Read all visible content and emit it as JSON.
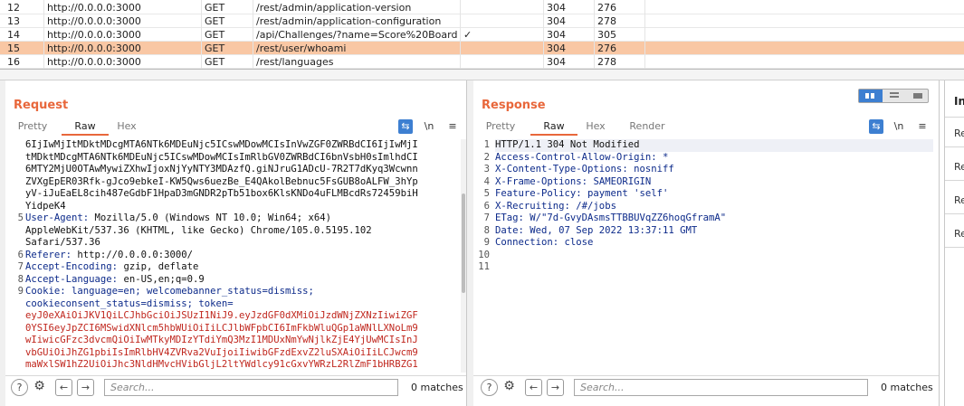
{
  "history": {
    "rows": [
      {
        "num": "12",
        "host": "http://0.0.0.0:3000",
        "method": "GET",
        "url": "/rest/admin/application-version",
        "params": "",
        "status": "304",
        "length": "276",
        "selected": false
      },
      {
        "num": "13",
        "host": "http://0.0.0.0:3000",
        "method": "GET",
        "url": "/rest/admin/application-configuration",
        "params": "",
        "status": "304",
        "length": "278",
        "selected": false
      },
      {
        "num": "14",
        "host": "http://0.0.0.0:3000",
        "method": "GET",
        "url": "/api/Challenges/?name=Score%20Board",
        "params": "✓",
        "status": "304",
        "length": "305",
        "selected": false
      },
      {
        "num": "15",
        "host": "http://0.0.0.0:3000",
        "method": "GET",
        "url": "/rest/user/whoami",
        "params": "",
        "status": "304",
        "length": "276",
        "selected": true
      },
      {
        "num": "16",
        "host": "http://0.0.0.0:3000",
        "method": "GET",
        "url": "/rest/languages",
        "params": "",
        "status": "304",
        "length": "278",
        "selected": false
      }
    ]
  },
  "request": {
    "title": "Request",
    "tabs": [
      "Pretty",
      "Raw",
      "Hex"
    ],
    "active_tab": "Raw",
    "wrap_icon": "wrap-lines-icon",
    "newline_label": "\\n",
    "menu_icon": "hamburger-menu-icon",
    "lines": [
      {
        "n": "",
        "k": "",
        "v": "6IjIwMjItMDktMDcgMTA6NTk6MDEuNjc5ICswMDowMCIsInVwZGF0ZWRBdCI6IjIwMjI",
        "cls": "hv"
      },
      {
        "n": "",
        "k": "",
        "v": "tMDktMDcgMTA6NTk6MDEuNjc5ICswMDowMCIsImRlbGV0ZWRBdCI6bnVsbH0sImlhdCI",
        "cls": "hv"
      },
      {
        "n": "",
        "k": "",
        "v": "6MTY2MjU0OTAwMywiZXhwIjoxNjYyNTY3MDAzfQ.giNJruG1ADcU-7R2T7dKyq3Wcwnn",
        "cls": "hv"
      },
      {
        "n": "",
        "k": "",
        "v": "ZVXgEpER03Rfk-gJco9ebkeI-KW5Qws6uezBe_E4QAkolBebnuc5FsGUB8oALFW_3hYp",
        "cls": "hv"
      },
      {
        "n": "",
        "k": "",
        "v": "yV-iJuEaEL8cih487eGdbF1HpaD3mGNDR2pTb51box6KlsKNDo4uFLMBcdRs72459biH",
        "cls": "hv"
      },
      {
        "n": "",
        "k": "",
        "v": "YidpeK4",
        "cls": "hv"
      },
      {
        "n": "5",
        "k": "User-Agent:",
        "v": " Mozilla/5.0 (Windows NT 10.0; Win64; x64)",
        "cls": "hv"
      },
      {
        "n": "",
        "k": "",
        "v": "AppleWebKit/537.36 (KHTML, like Gecko) Chrome/105.0.5195.102",
        "cls": "hv"
      },
      {
        "n": "",
        "k": "",
        "v": "Safari/537.36",
        "cls": "hv"
      },
      {
        "n": "6",
        "k": "Referer:",
        "v": " http://0.0.0.0:3000/",
        "cls": "hv"
      },
      {
        "n": "7",
        "k": "Accept-Encoding:",
        "v": " gzip, deflate",
        "cls": "hv"
      },
      {
        "n": "8",
        "k": "Accept-Language:",
        "v": " en-US,en;q=0.9",
        "cls": "hv"
      },
      {
        "n": "9",
        "k": "Cookie:",
        "v": " language=en; welcomebanner_status=dismiss;",
        "cls": "hk"
      },
      {
        "n": "",
        "k": "",
        "v": "cookieconsent_status=dismiss; token=",
        "cls": "hk"
      },
      {
        "n": "",
        "k": "",
        "v": "eyJ0eXAiOiJKV1QiLCJhbGciOiJSUzI1NiJ9.eyJzdGF0dXMiOiJzdWNjZXNzIiwiZGF",
        "cls": "tok"
      },
      {
        "n": "",
        "k": "",
        "v": "0YSI6eyJpZCI6MSwidXNlcm5hbWUiOiIiLCJlbWFpbCI6ImFkbWluQGp1aWNlLXNoLm9",
        "cls": "tok"
      },
      {
        "n": "",
        "k": "",
        "v": "wIiwicGFzc3dvcmQiOiIwMTkyMDIzYTdiYmQ3MzI1MDUxNmYwNjlkZjE4YjUwMCIsInJ",
        "cls": "tok"
      },
      {
        "n": "",
        "k": "",
        "v": "vbGUiOiJhZG1pbiIsImRlbHV4ZVRva2VuIjoiIiwibGFzdExvZ2luSXAiOiIiLCJwcm9",
        "cls": "tok"
      },
      {
        "n": "",
        "k": "",
        "v": "maWxlSW1hZ2UiOiJhc3NldHMvcHVibGljL2ltYWdlcy91cGxvYWRzL2RlZmF1bHRBZG1",
        "cls": "tok"
      }
    ],
    "search_placeholder": "Search...",
    "matches": "0 matches"
  },
  "response": {
    "title": "Response",
    "tabs": [
      "Pretty",
      "Raw",
      "Hex",
      "Render"
    ],
    "active_tab": "Raw",
    "newline_label": "\\n",
    "lines": [
      {
        "n": "1",
        "k": "",
        "v": "HTTP/1.1 304 Not Modified"
      },
      {
        "n": "2",
        "k": "Access-Control-Allow-Origin:",
        "v": " *"
      },
      {
        "n": "3",
        "k": "X-Content-Type-Options:",
        "v": " nosniff"
      },
      {
        "n": "4",
        "k": "X-Frame-Options:",
        "v": " SAMEORIGIN"
      },
      {
        "n": "5",
        "k": "Feature-Policy:",
        "v": " payment 'self'"
      },
      {
        "n": "6",
        "k": "X-Recruiting:",
        "v": " /#/jobs"
      },
      {
        "n": "7",
        "k": "ETag:",
        "v": " W/\"7d-GvyDAsmsTTBBUVqZZ6hoqGframA\""
      },
      {
        "n": "8",
        "k": "Date:",
        "v": " Wed, 07 Sep 2022 13:37:11 GMT"
      },
      {
        "n": "9",
        "k": "Connection:",
        "v": " close"
      },
      {
        "n": "10",
        "k": "",
        "v": ""
      },
      {
        "n": "11",
        "k": "",
        "v": ""
      }
    ],
    "search_placeholder": "Search...",
    "matches": "0 matches"
  },
  "inspector": {
    "title": "Ins",
    "items": [
      "Re",
      "Re",
      "Re",
      "Re"
    ]
  },
  "icons": {
    "help": "?",
    "settings": "⚙",
    "back": "←",
    "forward": "→"
  },
  "colors": {
    "accent": "#e8673b",
    "selected_row": "#f9c7a4",
    "header_key": "#0c2a8a",
    "token": "#c0271e",
    "toggle_blue": "#3d7fd1"
  }
}
